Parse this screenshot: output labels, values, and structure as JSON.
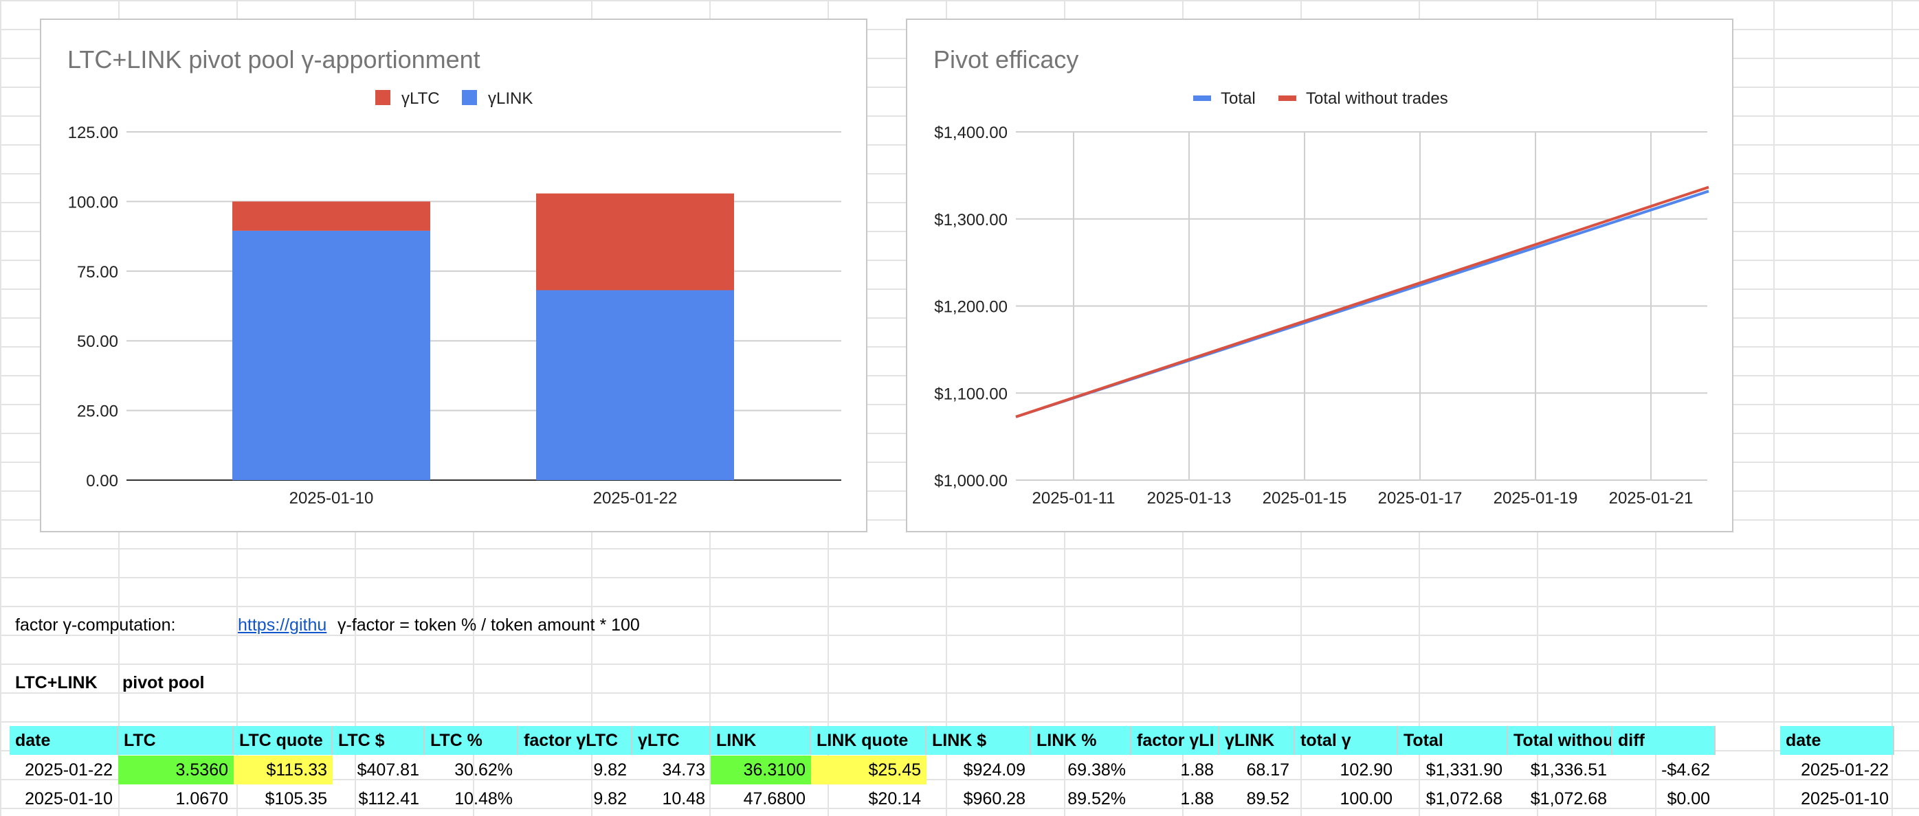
{
  "charts": {
    "stacked": {
      "title": "LTC+LINK pivot pool γ-apportionment",
      "legend": [
        "γLTC",
        "γLINK"
      ]
    },
    "line": {
      "title": "Pivot efficacy",
      "legend": [
        "Total",
        "Total without trades"
      ]
    }
  },
  "chart_data": [
    {
      "type": "bar",
      "stacked": true,
      "title": "LTC+LINK pivot pool γ-apportionment",
      "categories": [
        "2025-01-10",
        "2025-01-22"
      ],
      "series": [
        {
          "name": "γLINK",
          "values": [
            89.52,
            68.17
          ],
          "color": "#5286ec"
        },
        {
          "name": "γLTC",
          "values": [
            10.48,
            34.73
          ],
          "color": "#d95140"
        }
      ],
      "yticks": [
        "0.00",
        "25.00",
        "50.00",
        "75.00",
        "100.00",
        "125.00"
      ],
      "ylim": [
        0,
        125
      ],
      "legend_position": "top",
      "grid": true
    },
    {
      "type": "line",
      "title": "Pivot efficacy",
      "x": [
        "2025-01-10",
        "2025-01-22"
      ],
      "series": [
        {
          "name": "Total",
          "values": [
            1072.68,
            1331.9
          ],
          "color": "#5286ec"
        },
        {
          "name": "Total without trades",
          "values": [
            1072.68,
            1336.51
          ],
          "color": "#d95140"
        }
      ],
      "xticks": [
        "2025-01-11",
        "2025-01-13",
        "2025-01-15",
        "2025-01-17",
        "2025-01-19",
        "2025-01-21"
      ],
      "yticks": [
        "$1,000.00",
        "$1,100.00",
        "$1,200.00",
        "$1,300.00",
        "$1,400.00"
      ],
      "ylim": [
        1000,
        1400
      ],
      "legend_position": "top",
      "grid": true
    }
  ],
  "sheet": {
    "factor_label": "factor γ-computation:",
    "factor_link": "https://githu",
    "factor_formula": "γ-factor = token % / token amount * 100",
    "pool_label_1": "LTC+LINK",
    "pool_label_2": "pivot pool",
    "headers": [
      "date",
      "LTC",
      "LTC quote",
      "LTC $",
      "LTC %",
      "factor γLTC",
      "γLTC",
      "LINK",
      "LINK quote",
      "LINK $",
      "LINK %",
      "factor γLI",
      "γLINK",
      "total γ",
      "Total",
      "Total withou",
      "diff"
    ],
    "side_header": "date",
    "rows": [
      [
        "2025-01-22",
        "3.5360",
        "$115.33",
        "$407.81",
        "30.62%",
        "9.82",
        "34.73",
        "36.3100",
        "$25.45",
        "$924.09",
        "69.38%",
        "1.88",
        "68.17",
        "102.90",
        "$1,331.90",
        "$1,336.51",
        "-$4.62"
      ],
      [
        "2025-01-10",
        "1.0670",
        "$105.35",
        "$112.41",
        "10.48%",
        "9.82",
        "10.48",
        "47.6800",
        "$20.14",
        "$960.28",
        "89.52%",
        "1.88",
        "89.52",
        "100.00",
        "$1,072.68",
        "$1,072.68",
        "$0.00"
      ]
    ],
    "side_rows": [
      "2025-01-22",
      "2025-01-10"
    ]
  }
}
